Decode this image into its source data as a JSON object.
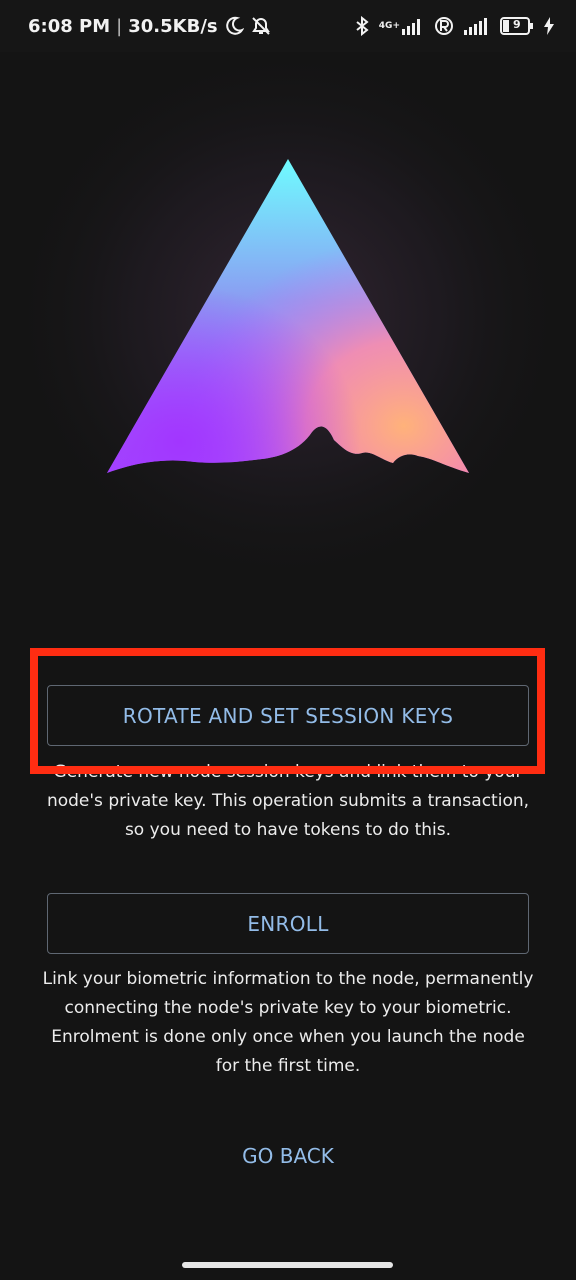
{
  "status_bar": {
    "time": "6:08 PM",
    "separator": "|",
    "speed": "30.5KB/s",
    "network_label": "4G+",
    "battery_level": "9",
    "icons": [
      "moon-icon",
      "alarm-off-icon",
      "bluetooth-icon",
      "signal-4g-icon",
      "roaming-icon",
      "signal-icon",
      "battery-icon",
      "charging-icon"
    ]
  },
  "hero": {
    "logo": "triangle-mountain-logo",
    "colors": [
      "#6ffcff",
      "#a64cff",
      "#ffb27a"
    ]
  },
  "actions": {
    "rotate_label": "ROTATE AND SET SESSION KEYS",
    "rotate_description": "Generate new node session keys and link them to your node's private key. This operation submits a transaction, so you need to have tokens to do this.",
    "enroll_label": "ENROLL",
    "enroll_description": "Link your biometric information to the node, permanently connecting the node's private key to your biometric. Enrolment is done only once when you launch the node for the first time.",
    "back_label": "GO BACK"
  },
  "colors": {
    "accent": "#93bce8",
    "highlight": "#ff2d12",
    "background": "#141414"
  }
}
